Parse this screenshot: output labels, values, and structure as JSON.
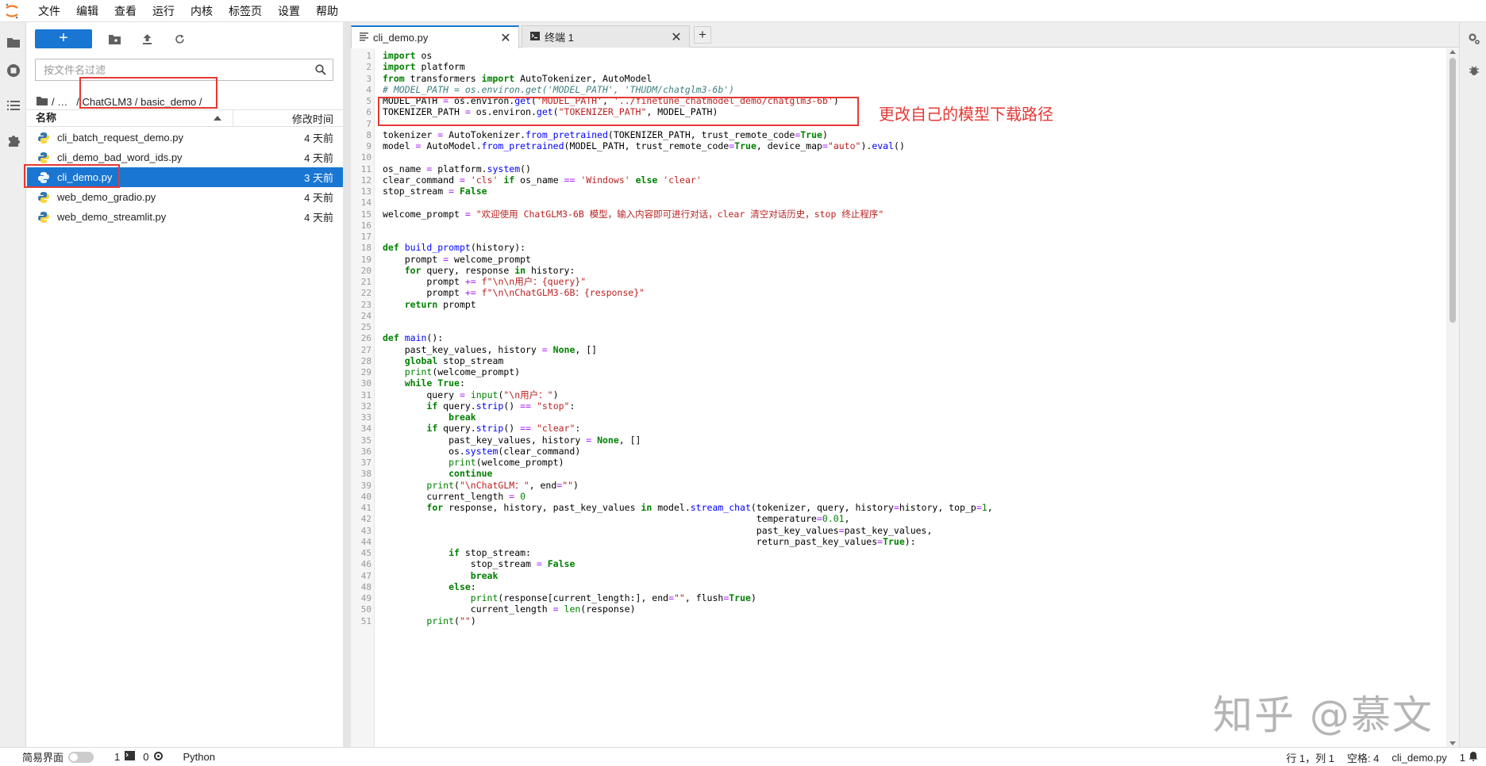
{
  "menubar": {
    "items": [
      "文件",
      "编辑",
      "查看",
      "运行",
      "内核",
      "标签页",
      "设置",
      "帮助"
    ]
  },
  "file_browser": {
    "new_label": "+",
    "filter_placeholder": "按文件名过滤",
    "breadcrumb": {
      "ellipsis": "/   …",
      "path": "/ ChatGLM3 / basic_demo /"
    },
    "column_name": "名称",
    "column_modified": "修改时间",
    "files": [
      {
        "name": "cli_batch_request_demo.py",
        "modified": "4 天前"
      },
      {
        "name": "cli_demo_bad_word_ids.py",
        "modified": "4 天前"
      },
      {
        "name": "cli_demo.py",
        "modified": "3 天前"
      },
      {
        "name": "web_demo_gradio.py",
        "modified": "4 天前"
      },
      {
        "name": "web_demo_streamlit.py",
        "modified": "4 天前"
      }
    ]
  },
  "tabs": [
    {
      "label": "cli_demo.py",
      "icon": "text-file-icon"
    },
    {
      "label": "终端 1",
      "icon": "terminal-icon"
    }
  ],
  "tab_add": "+",
  "annotation": "更改自己的模型下载路径",
  "watermark": "知乎 @慕文",
  "code_lines": [
    "import os",
    "import platform",
    "from transformers import AutoTokenizer, AutoModel",
    "# MODEL_PATH = os.environ.get('MODEL_PATH', 'THUDM/chatglm3-6b')",
    "MODEL_PATH = os.environ.get('MODEL_PATH', '../finetune_chatmodel_demo/chatglm3-6b')",
    "TOKENIZER_PATH = os.environ.get(\"TOKENIZER_PATH\", MODEL_PATH)",
    "",
    "tokenizer = AutoTokenizer.from_pretrained(TOKENIZER_PATH, trust_remote_code=True)",
    "model = AutoModel.from_pretrained(MODEL_PATH, trust_remote_code=True, device_map=\"auto\").eval()",
    "",
    "os_name = platform.system()",
    "clear_command = 'cls' if os_name == 'Windows' else 'clear'",
    "stop_stream = False",
    "",
    "welcome_prompt = \"欢迎使用 ChatGLM3-6B 模型，输入内容即可进行对话，clear 清空对话历史，stop 终止程序\"",
    "",
    "",
    "def build_prompt(history):",
    "    prompt = welcome_prompt",
    "    for query, response in history:",
    "        prompt += f\"\\n\\n用户：{query}\"",
    "        prompt += f\"\\n\\nChatGLM3-6B：{response}\"",
    "    return prompt",
    "",
    "",
    "def main():",
    "    past_key_values, history = None, []",
    "    global stop_stream",
    "    print(welcome_prompt)",
    "    while True:",
    "        query = input(\"\\n用户：\")",
    "        if query.strip() == \"stop\":",
    "            break",
    "        if query.strip() == \"clear\":",
    "            past_key_values, history = None, []",
    "            os.system(clear_command)",
    "            print(welcome_prompt)",
    "            continue",
    "        print(\"\\nChatGLM：\", end=\"\")",
    "        current_length = 0",
    "        for response, history, past_key_values in model.stream_chat(tokenizer, query, history=history, top_p=1,",
    "                                                                    temperature=0.01,",
    "                                                                    past_key_values=past_key_values,",
    "                                                                    return_past_key_values=True):",
    "            if stop_stream:",
    "                stop_stream = False",
    "                break",
    "            else:",
    "                print(response[current_length:], end=\"\", flush=True)",
    "                current_length = len(response)",
    "        print(\"\")"
  ],
  "statusbar": {
    "simple_mode": "简易界面",
    "terminals_count": "1",
    "kernels_count": "0",
    "kernel_name": "Python",
    "cursor": "行 1，列 1",
    "spaces": "空格: 4",
    "filename": "cli_demo.py",
    "notifications": "1"
  },
  "colors": {
    "accent": "#1976d2",
    "annotation_red": "#e53935"
  }
}
